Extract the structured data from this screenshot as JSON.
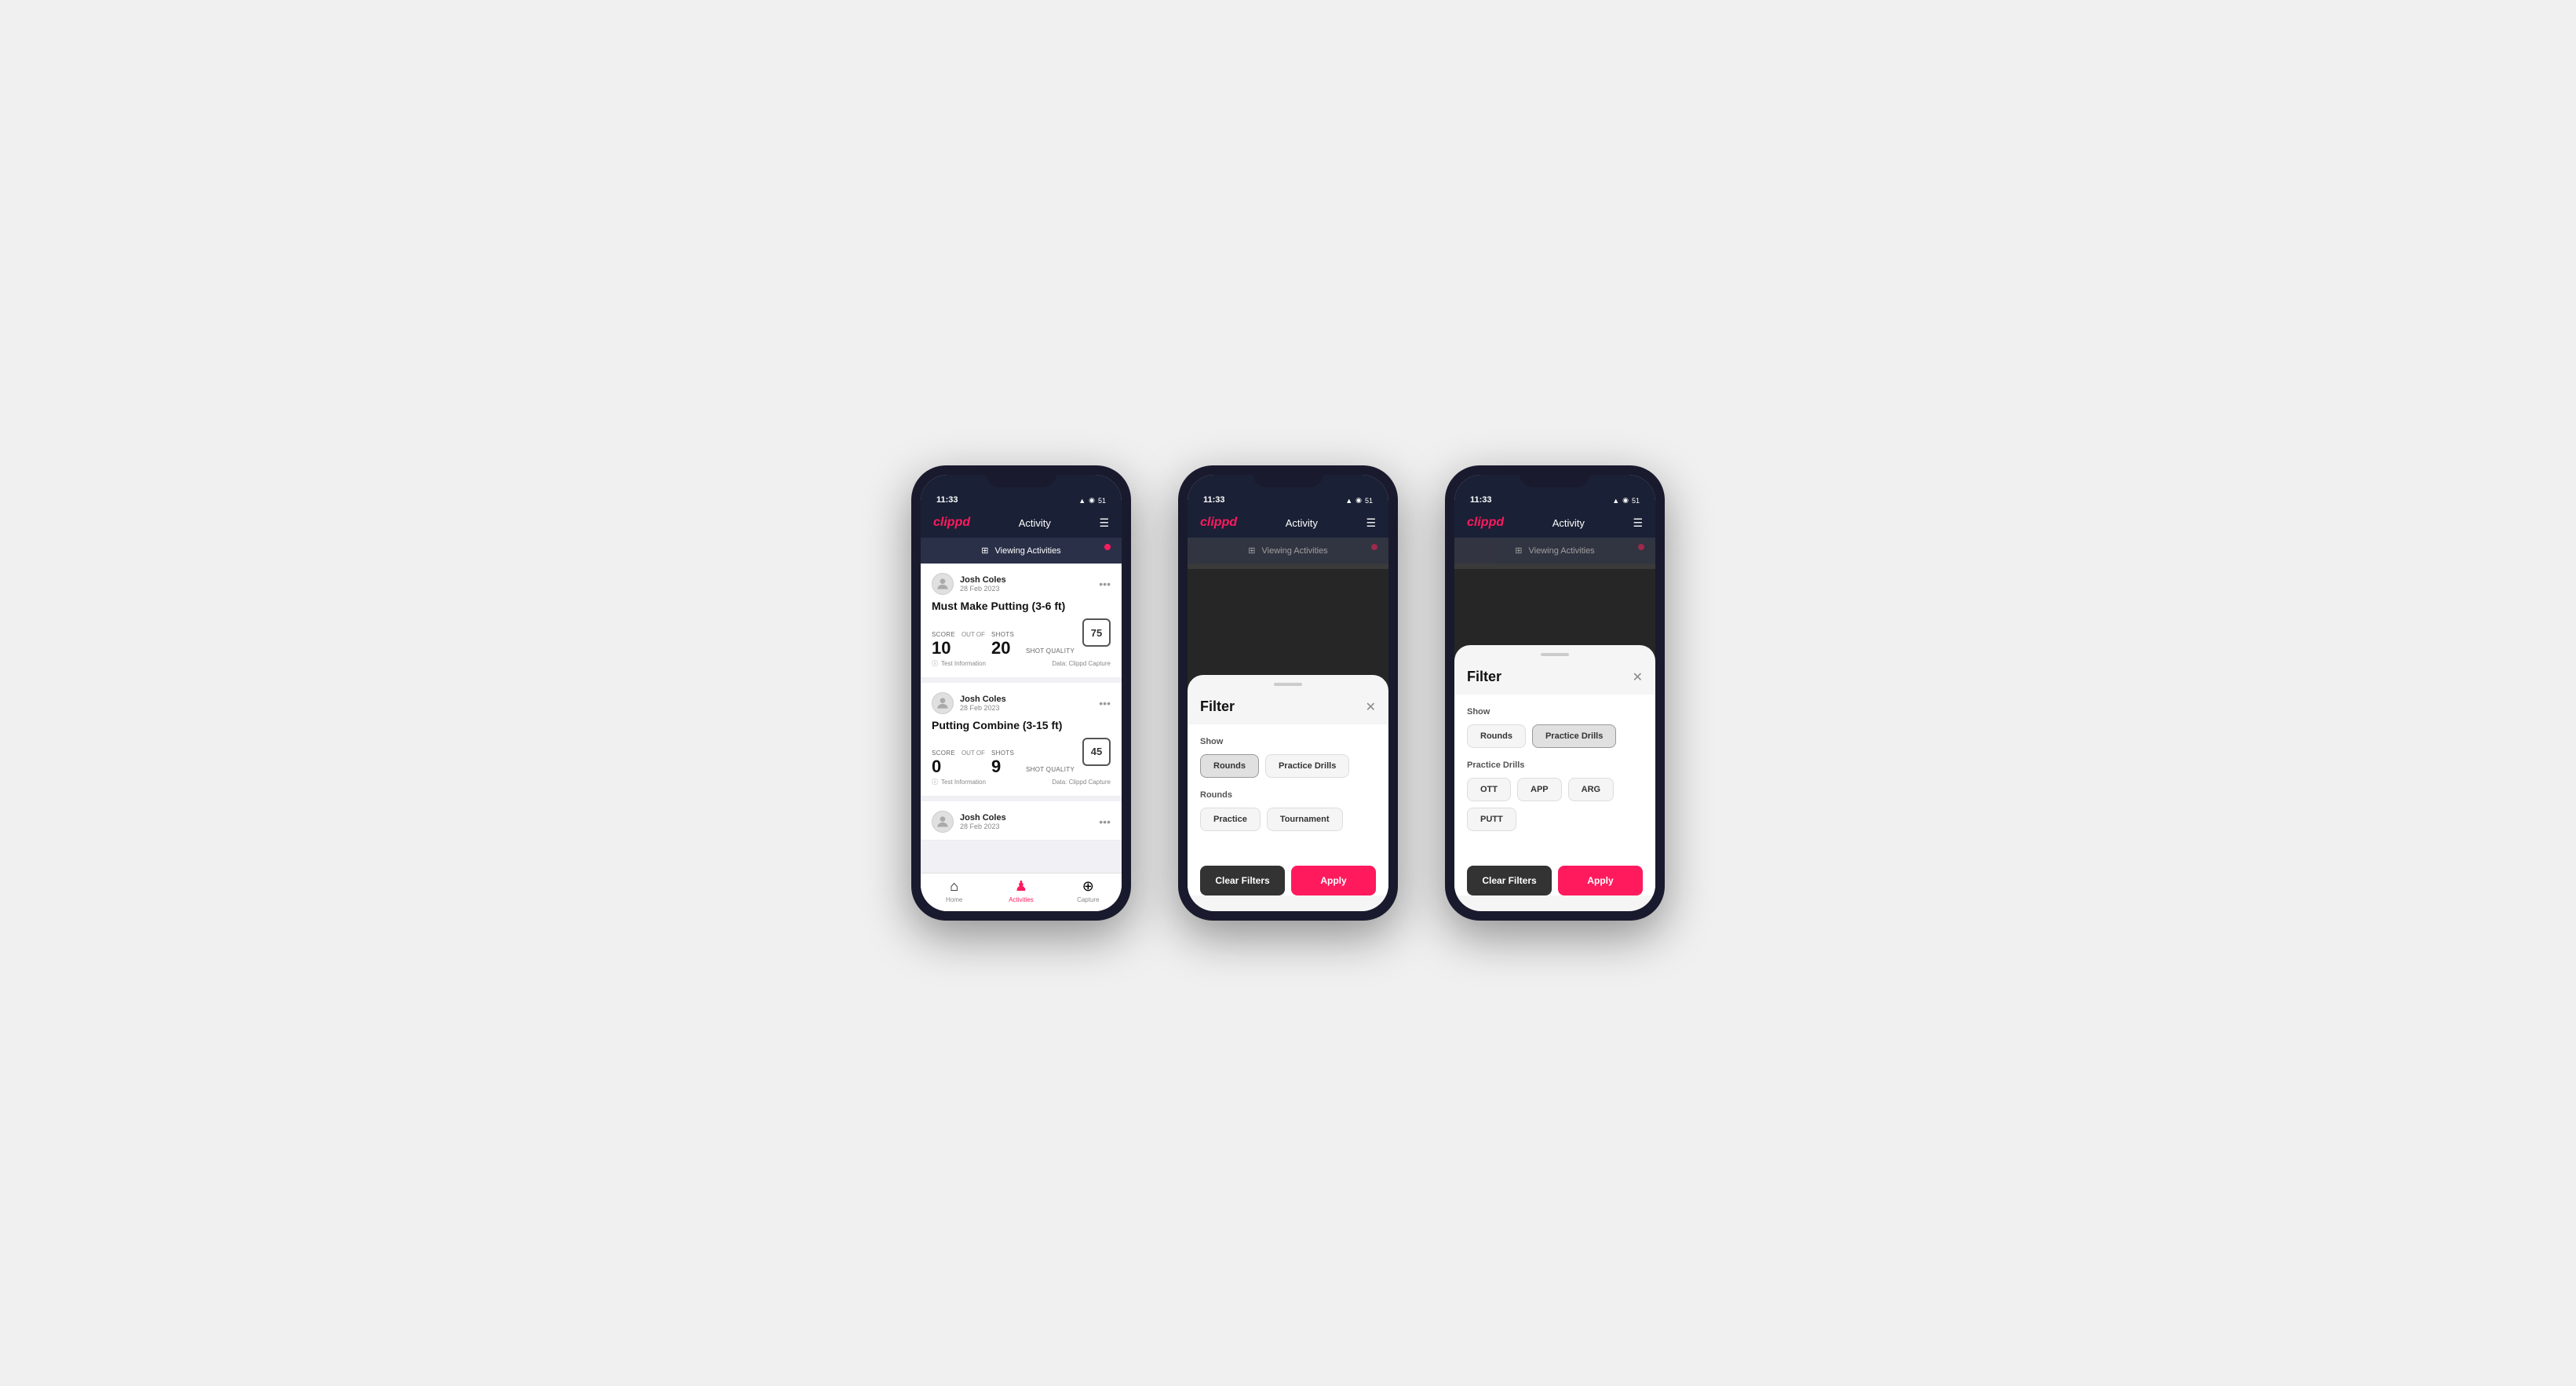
{
  "app": {
    "logo": "clippd",
    "nav_title": "Activity",
    "status_time": "11:33",
    "status_icons": "▲ ▼ ◉ 51"
  },
  "viewing_bar": {
    "text": "Viewing Activities",
    "icon": "⊞"
  },
  "phone1": {
    "activities": [
      {
        "user_name": "Josh Coles",
        "user_date": "28 Feb 2023",
        "title": "Must Make Putting (3-6 ft)",
        "score_label": "Score",
        "score_value": "10",
        "shots_label": "Shots",
        "shots_value": "20",
        "shot_quality_label": "Shot Quality",
        "shot_quality_value": "75",
        "test_info": "Test Information",
        "data_source": "Data: Clippd Capture"
      },
      {
        "user_name": "Josh Coles",
        "user_date": "28 Feb 2023",
        "title": "Putting Combine (3-15 ft)",
        "score_label": "Score",
        "score_value": "0",
        "shots_label": "Shots",
        "shots_value": "9",
        "shot_quality_label": "Shot Quality",
        "shot_quality_value": "45",
        "test_info": "Test Information",
        "data_source": "Data: Clippd Capture"
      },
      {
        "user_name": "Josh Coles",
        "user_date": "28 Feb 2023",
        "title": "",
        "score_label": "",
        "score_value": "",
        "shots_label": "",
        "shots_value": "",
        "shot_quality_label": "",
        "shot_quality_value": "",
        "test_info": "",
        "data_source": ""
      }
    ],
    "tabs": [
      {
        "label": "Home",
        "icon": "⌂",
        "active": false
      },
      {
        "label": "Activities",
        "icon": "♟",
        "active": true
      },
      {
        "label": "Capture",
        "icon": "⊕",
        "active": false
      }
    ]
  },
  "phone2": {
    "filter": {
      "title": "Filter",
      "show_label": "Show",
      "rounds_btn": "Rounds",
      "practice_drills_btn": "Practice Drills",
      "rounds_section_label": "Rounds",
      "practice_btn": "Practice",
      "tournament_btn": "Tournament",
      "clear_btn": "Clear Filters",
      "apply_btn": "Apply"
    }
  },
  "phone3": {
    "filter": {
      "title": "Filter",
      "show_label": "Show",
      "rounds_btn": "Rounds",
      "practice_drills_btn": "Practice Drills",
      "practice_drills_section_label": "Practice Drills",
      "ott_btn": "OTT",
      "app_btn": "APP",
      "arg_btn": "ARG",
      "putt_btn": "PUTT",
      "clear_btn": "Clear Filters",
      "apply_btn": "Apply"
    }
  }
}
